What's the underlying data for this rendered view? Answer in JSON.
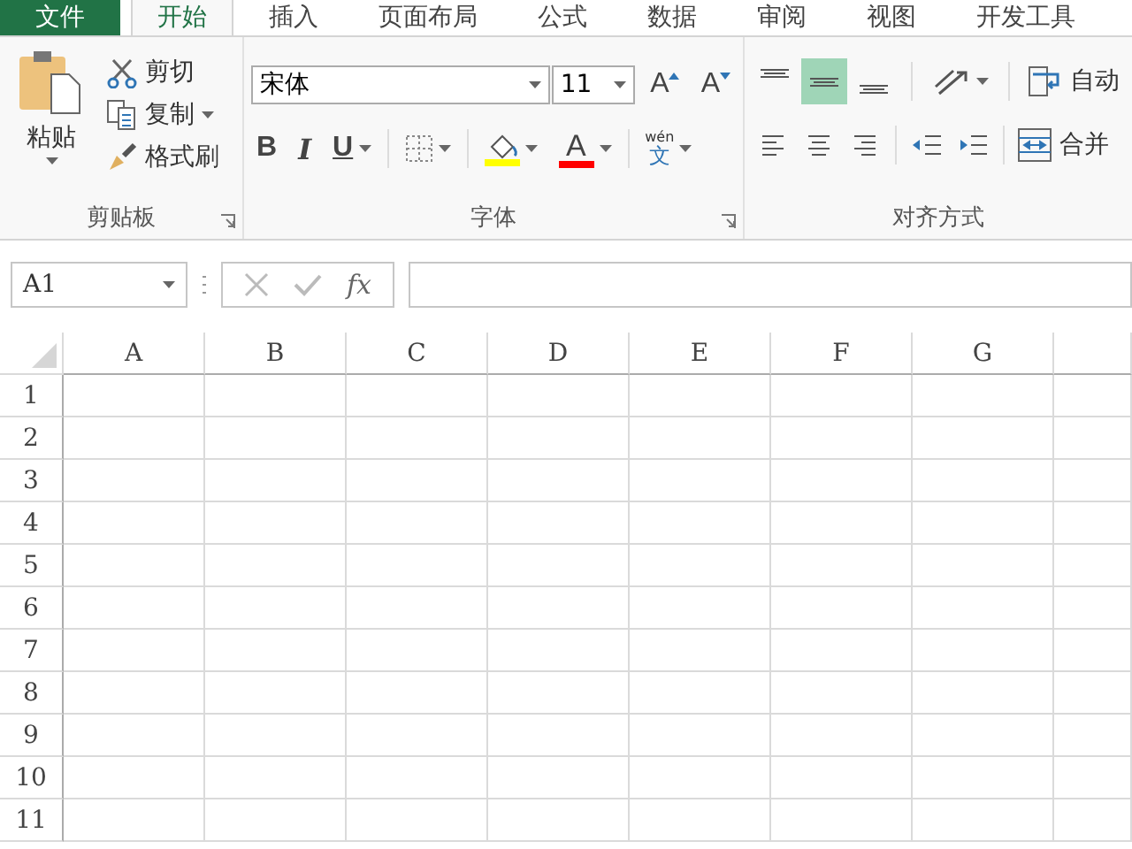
{
  "tabs": [
    {
      "label": "文件",
      "kind": "file",
      "selected": false
    },
    {
      "label": "开始",
      "kind": "tab",
      "selected": true
    },
    {
      "label": "插入",
      "kind": "tab",
      "selected": false
    },
    {
      "label": "页面布局",
      "kind": "tab",
      "selected": false
    },
    {
      "label": "公式",
      "kind": "tab",
      "selected": false
    },
    {
      "label": "数据",
      "kind": "tab",
      "selected": false
    },
    {
      "label": "审阅",
      "kind": "tab",
      "selected": false
    },
    {
      "label": "视图",
      "kind": "tab",
      "selected": false
    },
    {
      "label": "开发工具",
      "kind": "tab",
      "selected": false
    }
  ],
  "clipboard": {
    "paste": "粘贴",
    "cut": "剪切",
    "copy": "复制",
    "format_painter": "格式刷",
    "group_label": "剪贴板"
  },
  "font": {
    "font_name": "宋体",
    "font_size": "11",
    "grow": "A",
    "shrink": "A",
    "bold": "B",
    "italic": "I",
    "underline": "U",
    "font_color": "A",
    "phonetic_top": "wén",
    "phonetic_bottom": "文",
    "group_label": "字体"
  },
  "alignment": {
    "vertical": [
      {
        "kind": "top",
        "selected": false
      },
      {
        "kind": "middle",
        "selected": true
      },
      {
        "kind": "bottom",
        "selected": false
      }
    ],
    "horizontal": [
      {
        "kind": "left",
        "selected": false
      },
      {
        "kind": "center",
        "selected": false
      },
      {
        "kind": "right",
        "selected": false
      }
    ],
    "wrap_text": "自动",
    "merge": "合并",
    "group_label": "对齐方式"
  },
  "formula_bar": {
    "name_box": "A1",
    "fx": "fx"
  },
  "sheet": {
    "columns": [
      "A",
      "B",
      "C",
      "D",
      "E",
      "F",
      "G"
    ],
    "rows": [
      "1",
      "2",
      "3",
      "4",
      "5",
      "6",
      "7",
      "8",
      "9",
      "10",
      "11"
    ]
  }
}
